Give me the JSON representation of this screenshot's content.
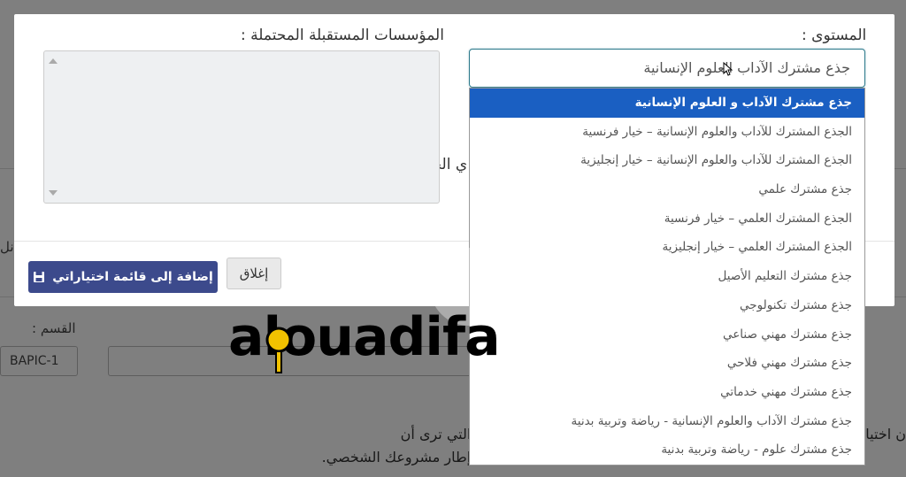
{
  "background": {
    "section_label": "القسم :",
    "code_value": "BAPIC-1",
    "side_fragment": "نل",
    "paragraph_line1": "ن اختيار... ي متابعة دراستك أو تكوينك بها بعد المستوى الدراسي الحالي، والتي ترى أن",
    "paragraph_line2": "الشعب المهنية المستقبلية في إطار مشروعك الشخصي."
  },
  "modal": {
    "level_label": "المستوى :",
    "institutions_label": "المؤسسات المستقبلة المحتملة :",
    "private_label": "ي الخصوصي محتضنة له :",
    "selected_value": "جذع مشترك الآداب العلوم الإنسانية",
    "add_button": "إضافة إلى قائمة اختياراتي",
    "close_button": "إغلاق"
  },
  "dropdown": {
    "options": [
      "جذع مشترك الآداب و العلوم الإنسانية",
      "الجذع المشترك للآداب والعلوم الإنسانية – خيار فرنسية",
      "الجذع المشترك للآداب والعلوم الإنسانية – خيار إنجليزية",
      "جذع مشترك علمي",
      "الجذع المشترك العلمي – خيار فرنسية",
      "الجذع المشترك العلمي – خيار إنجليزية",
      "جذع مشترك التعليم الأصيل",
      "جذع مشترك تكنولوجي",
      "جذع مشترك مهني صناعي",
      "جذع مشترك مهني فلاحي",
      "جذع مشترك مهني خدماتي",
      "جذع مشترك الآداب والعلوم الإنسانية - رياضة وتربية بدنية",
      "جذع مشترك علوم - رياضة وتربية بدنية"
    ],
    "selected_index": 0
  },
  "watermark": {
    "text": "alouadifa"
  },
  "colors": {
    "primary_button": "#3c4a8c",
    "selected_option": "#1a5fc2",
    "select_border": "#2d7a8c"
  },
  "icons": {
    "save": "floppy-disk-icon",
    "cursor": "mouse-pointer-icon",
    "scroll_up": "triangle-up-icon",
    "scroll_down": "triangle-down-icon"
  }
}
